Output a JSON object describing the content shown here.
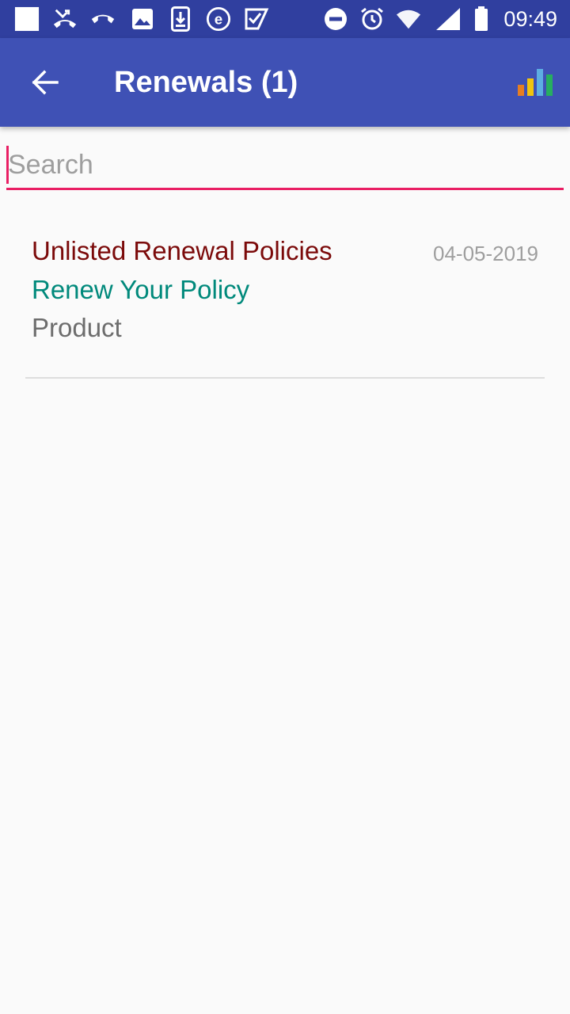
{
  "status_bar": {
    "time": "09:49",
    "left_icons": [
      "square-notification-icon",
      "missed-call-icon",
      "call-end-icon",
      "image-icon",
      "download-icon",
      "e-circle-icon",
      "check-badge-icon"
    ],
    "right_icons": [
      "dnd-icon",
      "alarm-icon",
      "wifi-icon",
      "signal-icon",
      "battery-icon"
    ],
    "background_color": "#303f9f"
  },
  "app_bar": {
    "title": "Renewals (1)",
    "back_icon": "arrow-back-icon",
    "action_icon": "bar-chart-icon",
    "background_color": "#3f51b5"
  },
  "search": {
    "placeholder": "Search",
    "value": "",
    "accent_color": "#e91e63"
  },
  "renewals": [
    {
      "title": "Unlisted Renewal Policies",
      "subtitle": "Renew Your Policy",
      "product": "Product",
      "date": "04-05-2019"
    }
  ],
  "colors": {
    "title": "#7b0a0a",
    "subtitle": "#00897b",
    "product": "#6d6d6d",
    "date": "#9e9e9e"
  }
}
